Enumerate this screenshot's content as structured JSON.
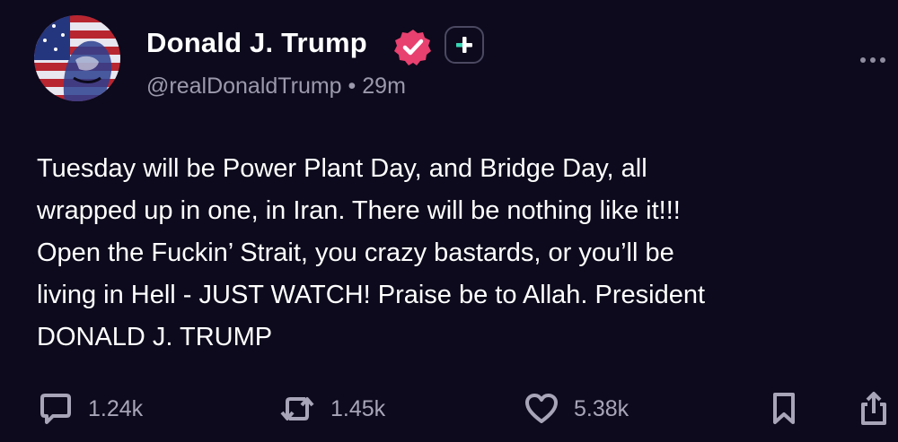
{
  "author": {
    "display_name": "Donald J. Trump",
    "handle": "@realDonaldTrump",
    "separator": "•",
    "time_ago": "29m",
    "verified": true
  },
  "post": {
    "text": "Tuesday will be Power Plant Day, and Bridge Day, all\nwrapped up in one, in Iran. There will be nothing like it!!!\nOpen the Fuckin’ Strait, you crazy bastards, or you’ll be\nliving in Hell - JUST WATCH! Praise be to Allah. President\nDONALD J. TRUMP"
  },
  "actions": {
    "replies": "1.24k",
    "reposts": "1.45k",
    "likes": "5.38k"
  },
  "icons": {
    "verified": "verified-badge-icon",
    "follow": "plus-icon",
    "more": "more-dots-icon",
    "reply": "comment-icon",
    "repost": "repost-icon",
    "like": "heart-icon",
    "bookmark": "bookmark-icon",
    "share": "share-icon"
  },
  "colors": {
    "background": "#0c0a1c",
    "verified_badge": "#e8406f",
    "follow_plus": "#35d6b5",
    "muted_text": "#9c99ad"
  }
}
